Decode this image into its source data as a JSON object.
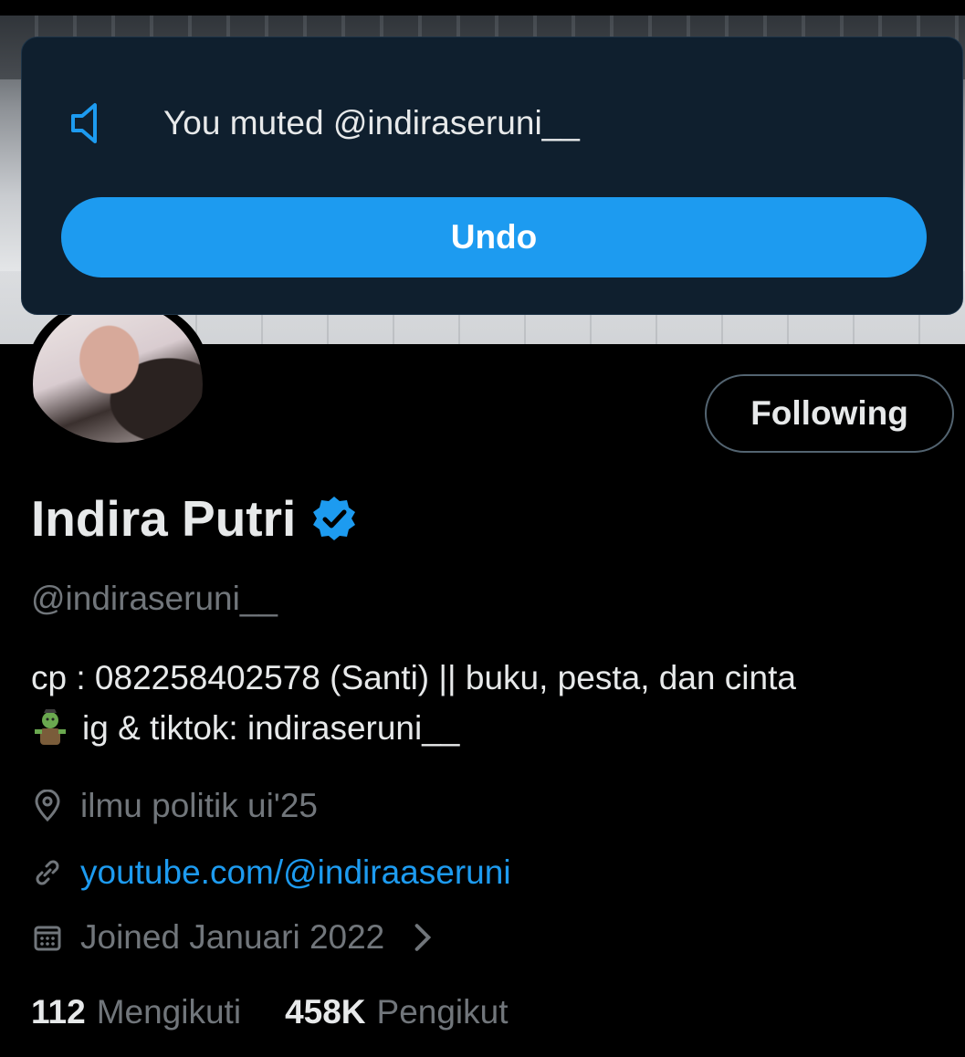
{
  "toast": {
    "icon": "speaker-muted-icon",
    "message": "You muted @indiraseruni__",
    "undo_label": "Undo"
  },
  "profile": {
    "name": "Indira Putri",
    "verified": true,
    "handle": "@indiraseruni__",
    "follow_label": "Following",
    "bio_line1": "cp : 082258402578 (Santi) || buku, pesta, dan cinta",
    "bio_line2": "ig & tiktok: indiraseruni__",
    "location": "ilmu politik ui'25",
    "website": "youtube.com/@indiraaseruni",
    "joined": "Joined Januari 2022",
    "following_count": "112",
    "following_label": "Mengikuti",
    "followers_count": "458K",
    "followers_label": "Pengikut"
  },
  "colors": {
    "accent": "#1d9bf0",
    "toast_bg": "#0f1f2e",
    "muted_text": "#71767b"
  }
}
